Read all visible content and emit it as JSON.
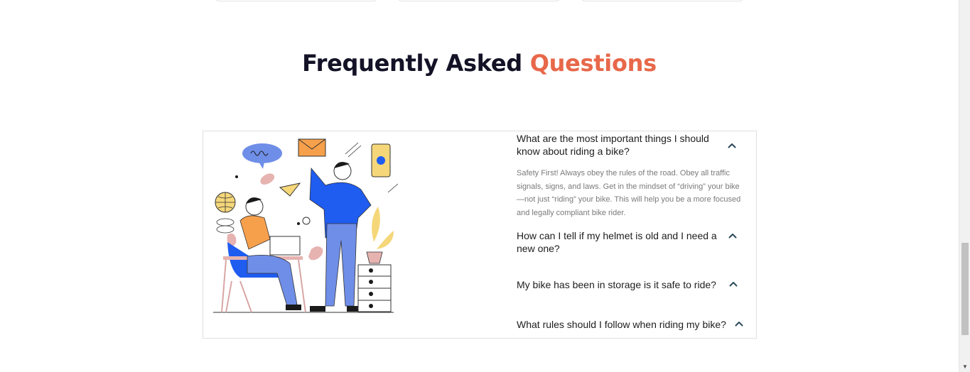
{
  "faq": {
    "title_main": "Frequently Asked",
    "title_accent": "Questions",
    "items": [
      {
        "question": "What are the most important things I should know about riding a bike?",
        "answer": "Safety First! Always obey the rules of the road. Obey all traffic signals, signs, and laws. Get in the mindset of “driving” your bike—not just “riding” your bike. This will help you be a more focused and legally compliant bike rider.",
        "expanded": true
      },
      {
        "question": "How can I tell if my helmet is old and I need a new one?",
        "expanded": false
      },
      {
        "question": "My bike has been in storage is it safe to ride?",
        "expanded": false
      },
      {
        "question": "What rules should I follow when riding my bike?",
        "expanded": false
      }
    ]
  },
  "icons": {
    "toggle": "chevron-up-icon",
    "scroll_down": "arrow-down-icon"
  },
  "colors": {
    "accent": "#e8684a",
    "heading": "#141226",
    "chevron": "#2b4a5a",
    "illustration_blue": "#1f5cf0",
    "illustration_orange": "#f7a04b"
  }
}
